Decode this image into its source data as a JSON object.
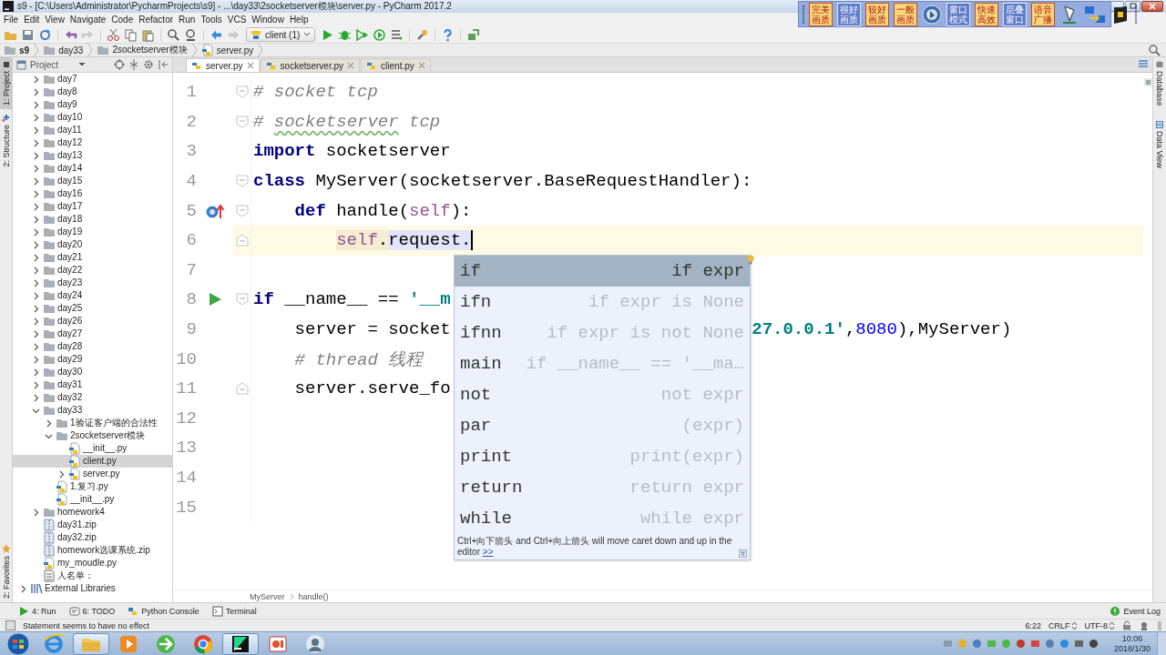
{
  "window": {
    "title": "s9 - [C:\\Users\\Administrator\\PycharmProjects\\s9] - ...\\day33\\2socketserver模块\\server.py - PyCharm 2017.2"
  },
  "recorder_toolbar": [
    {
      "kind": "text",
      "label": "完美画质",
      "highlighted": true
    },
    {
      "kind": "text",
      "label": "很好画质",
      "highlighted": false
    },
    {
      "kind": "text",
      "label": "较好画质",
      "highlighted": true
    },
    {
      "kind": "text",
      "label": "一般画质",
      "highlighted": true
    },
    {
      "kind": "pin"
    },
    {
      "kind": "text",
      "label": "窗口模式",
      "highlighted": false
    },
    {
      "kind": "text",
      "label": "快速高效",
      "highlighted": true
    },
    {
      "kind": "text",
      "label": "层叠窗口",
      "highlighted": false
    },
    {
      "kind": "text",
      "label": "语音广播",
      "highlighted": true
    },
    {
      "kind": "pen"
    },
    {
      "kind": "swap"
    },
    {
      "kind": "exit"
    }
  ],
  "menu": [
    "File",
    "Edit",
    "View",
    "Navigate",
    "Code",
    "Refactor",
    "Run",
    "Tools",
    "VCS",
    "Window",
    "Help"
  ],
  "toolbar": {
    "run_config": "client (1)"
  },
  "nav_bar": [
    {
      "label": "s9",
      "kind": "folder"
    },
    {
      "label": "day33",
      "kind": "folder"
    },
    {
      "label": "2socketserver模块",
      "kind": "folder"
    },
    {
      "label": "server.py",
      "kind": "python"
    }
  ],
  "left_stripe": [
    {
      "label": "1: Project",
      "kind": "project",
      "selected": true
    },
    {
      "label": "2: Structure",
      "kind": "structure",
      "selected": false
    }
  ],
  "favorites": "2: Favorites",
  "project_panel": {
    "title": "Project",
    "items": [
      {
        "label": "day7",
        "kind": "folder",
        "expanded": false,
        "selected": false
      },
      {
        "label": "day8",
        "kind": "folder",
        "expanded": false,
        "selected": false
      },
      {
        "label": "day9",
        "kind": "folder",
        "expanded": false,
        "selected": false
      },
      {
        "label": "day10",
        "kind": "folder",
        "expanded": false,
        "selected": false
      },
      {
        "label": "day11",
        "kind": "folder",
        "expanded": false,
        "selected": false
      },
      {
        "label": "day12",
        "kind": "folder",
        "expanded": false,
        "selected": false
      },
      {
        "label": "day13",
        "kind": "folder",
        "expanded": false,
        "selected": false
      },
      {
        "label": "day14",
        "kind": "folder",
        "expanded": false,
        "selected": false
      },
      {
        "label": "day15",
        "kind": "folder",
        "expanded": false,
        "selected": false
      },
      {
        "label": "day16",
        "kind": "folder",
        "expanded": false,
        "selected": false
      },
      {
        "label": "day17",
        "kind": "folder",
        "expanded": false,
        "selected": false
      },
      {
        "label": "day18",
        "kind": "folder",
        "expanded": false,
        "selected": false
      },
      {
        "label": "day19",
        "kind": "folder",
        "expanded": false,
        "selected": false
      },
      {
        "label": "day20",
        "kind": "folder",
        "expanded": false,
        "selected": false
      },
      {
        "label": "day21",
        "kind": "folder",
        "expanded": false,
        "selected": false
      },
      {
        "label": "day22",
        "kind": "folder",
        "expanded": false,
        "selected": false
      },
      {
        "label": "day23",
        "kind": "folder",
        "expanded": false,
        "selected": false
      },
      {
        "label": "day24",
        "kind": "folder",
        "expanded": false,
        "selected": false
      },
      {
        "label": "day25",
        "kind": "folder",
        "expanded": false,
        "selected": false
      },
      {
        "label": "day26",
        "kind": "folder",
        "expanded": false,
        "selected": false
      },
      {
        "label": "day27",
        "kind": "folder",
        "expanded": false,
        "selected": false
      },
      {
        "label": "day28",
        "kind": "folder",
        "expanded": false,
        "selected": false
      },
      {
        "label": "day29",
        "kind": "folder",
        "expanded": false,
        "selected": false
      },
      {
        "label": "day30",
        "kind": "folder",
        "expanded": false,
        "selected": false
      },
      {
        "label": "day31",
        "kind": "folder",
        "expanded": false,
        "selected": false
      },
      {
        "label": "day32",
        "kind": "folder",
        "expanded": false,
        "selected": false
      },
      {
        "label": "day33",
        "kind": "folder",
        "expanded": true,
        "selected": false,
        "children": [
          {
            "label": "1验证客户端的合法性",
            "kind": "folder",
            "expanded": false,
            "selected": false
          },
          {
            "label": "2socketserver模块",
            "kind": "folder",
            "expanded": true,
            "selected": false,
            "children": [
              {
                "label": "__init__.py",
                "kind": "python",
                "selected": false
              },
              {
                "label": "client.py",
                "kind": "python",
                "selected": true
              },
              {
                "label": "server.py",
                "kind": "python",
                "expanded": false,
                "selected": false
              }
            ]
          },
          {
            "label": "1.复习.py",
            "kind": "python",
            "selected": false
          },
          {
            "label": "__init__.py",
            "kind": "python",
            "selected": false
          }
        ]
      },
      {
        "label": "homework4",
        "kind": "folder",
        "expanded": false,
        "selected": false
      },
      {
        "label": "day31.zip",
        "kind": "zip",
        "selected": false
      },
      {
        "label": "day32.zip",
        "kind": "zip",
        "selected": false
      },
      {
        "label": "homework选课系统.zip",
        "kind": "zip",
        "selected": false
      },
      {
        "label": "my_moudle.py",
        "kind": "python",
        "selected": false
      },
      {
        "label": "人名单：",
        "kind": "text",
        "selected": false
      }
    ],
    "root_items": [
      {
        "label": "External Libraries",
        "kind": "libraries",
        "expanded": false,
        "selected": false
      }
    ]
  },
  "editor_tabs": [
    {
      "label": "server.py",
      "selected": true
    },
    {
      "label": "socketserver.py",
      "selected": false
    },
    {
      "label": "client.py",
      "selected": false
    }
  ],
  "editor": {
    "lines": [
      {
        "number": "1",
        "current": false,
        "gutter_icons": [
          {
            "kind": "fold-start"
          }
        ],
        "tokens": [
          {
            "text": "# socket tcp",
            "kind": "comment"
          }
        ]
      },
      {
        "number": "2",
        "current": false,
        "gutter_icons": [
          {
            "kind": "fold-start"
          }
        ],
        "tokens": [
          {
            "text": "# ",
            "kind": "comment"
          },
          {
            "text": "socketserver",
            "kind": "comment-typo"
          },
          {
            "text": " tcp",
            "kind": "comment"
          }
        ]
      },
      {
        "number": "3",
        "current": false,
        "tokens": [
          {
            "text": "import",
            "kind": "keyword"
          },
          {
            "text": " socketserver",
            "kind": "plain"
          }
        ]
      },
      {
        "number": "4",
        "current": false,
        "gutter_icons": [
          {
            "kind": "fold-start"
          }
        ],
        "tokens": [
          {
            "text": "class",
            "kind": "keyword"
          },
          {
            "text": " MyServer(socketserver.BaseRequestHandler):",
            "kind": "plain"
          }
        ]
      },
      {
        "number": "5",
        "current": false,
        "kind": "indent-1",
        "gutter_icons": [
          {
            "kind": "override"
          },
          {
            "kind": "fold-start"
          }
        ],
        "tokens": [
          {
            "text": "def",
            "kind": "keyword"
          },
          {
            "text": " handle(",
            "kind": "plain"
          },
          {
            "text": "self",
            "kind": "self"
          },
          {
            "text": "):",
            "kind": "plain"
          }
        ]
      },
      {
        "number": "6",
        "current": true,
        "kind": "indent-2",
        "gutter_icons": [
          {
            "kind": "fold-end"
          }
        ],
        "tokens": [
          {
            "text": "self",
            "kind": "self-usage"
          },
          {
            "text": ".",
            "kind": "usage"
          },
          {
            "text": "request.",
            "kind": "ref-usage"
          }
        ]
      },
      {
        "number": "7",
        "current": false
      },
      {
        "number": "8",
        "current": false,
        "gutter_icons": [
          {
            "kind": "run"
          },
          {
            "kind": "fold-start"
          }
        ],
        "tokens": [
          {
            "text": "if",
            "kind": "keyword"
          },
          {
            "text": " __name__ == ",
            "kind": "plain"
          },
          {
            "text": "'__m",
            "kind": "string"
          }
        ]
      },
      {
        "number": "9",
        "current": false,
        "kind": "indent-1",
        "tokens": [
          {
            "text": "server = socket",
            "kind": "plain"
          }
        ],
        "tail": [
          {
            "text": "27.0.0.1'",
            "kind": "string"
          },
          {
            "text": ",",
            "kind": "plain"
          },
          {
            "text": "8080",
            "kind": "number"
          },
          {
            "text": "),MyServer)",
            "kind": "plain"
          }
        ]
      },
      {
        "number": "10",
        "current": false,
        "kind": "indent-1",
        "tokens": [
          {
            "text": "# thread 线程",
            "kind": "comment"
          }
        ]
      },
      {
        "number": "11",
        "current": false,
        "kind": "indent-1",
        "gutter_icons": [
          {
            "kind": "fold-end"
          }
        ],
        "tokens": [
          {
            "text": "server.serve_fo",
            "kind": "plain"
          }
        ]
      },
      {
        "number": "12",
        "current": false
      },
      {
        "number": "13",
        "current": false
      },
      {
        "number": "14",
        "current": false
      },
      {
        "number": "15",
        "current": false
      }
    ],
    "breadcrumb": [
      "MyServer",
      "handle()"
    ]
  },
  "completion": {
    "items": [
      {
        "name": "if",
        "hint": "if expr",
        "selected": true
      },
      {
        "name": "ifn",
        "hint": "if expr is None",
        "selected": false
      },
      {
        "name": "ifnn",
        "hint": "if expr is not None",
        "selected": false
      },
      {
        "name": "main",
        "hint": "if __name__ == '__ma…",
        "selected": false
      },
      {
        "name": "not",
        "hint": "not expr",
        "selected": false
      },
      {
        "name": "par",
        "hint": "(expr)",
        "selected": false
      },
      {
        "name": "print",
        "hint": "print(expr)",
        "selected": false
      },
      {
        "name": "return",
        "hint": "return expr",
        "selected": false
      },
      {
        "name": "while",
        "hint": "while expr",
        "selected": false
      }
    ],
    "footer": "Ctrl+向下箭头 and Ctrl+向上箭头 will move caret down and up in the editor",
    "footer_link": ">>"
  },
  "right_stripe": [
    "Database",
    "Data View"
  ],
  "tool_tabs": [
    {
      "label": "4: Run",
      "kind": "run"
    },
    {
      "label": "6: TODO",
      "kind": "todo"
    },
    {
      "label": "Python Console",
      "kind": "console"
    },
    {
      "label": "Terminal",
      "kind": "terminal"
    }
  ],
  "event_log": "Event Log",
  "status_bar": {
    "message": "Statement seems to have no effect",
    "position": "6:22",
    "line_separator": "CRLF",
    "encoding": "UTF-8"
  },
  "taskbar": {
    "apps": [
      {
        "kind": "ie",
        "selected": false
      },
      {
        "kind": "explorer",
        "selected": true
      },
      {
        "kind": "media",
        "selected": false
      },
      {
        "kind": "green-browser",
        "selected": false
      },
      {
        "kind": "chrome",
        "selected": false
      },
      {
        "kind": "ide",
        "selected": true
      },
      {
        "kind": "slides",
        "selected": false
      },
      {
        "kind": "avatar",
        "selected": false
      }
    ],
    "time": "10:06",
    "date": "2018/1/30"
  }
}
